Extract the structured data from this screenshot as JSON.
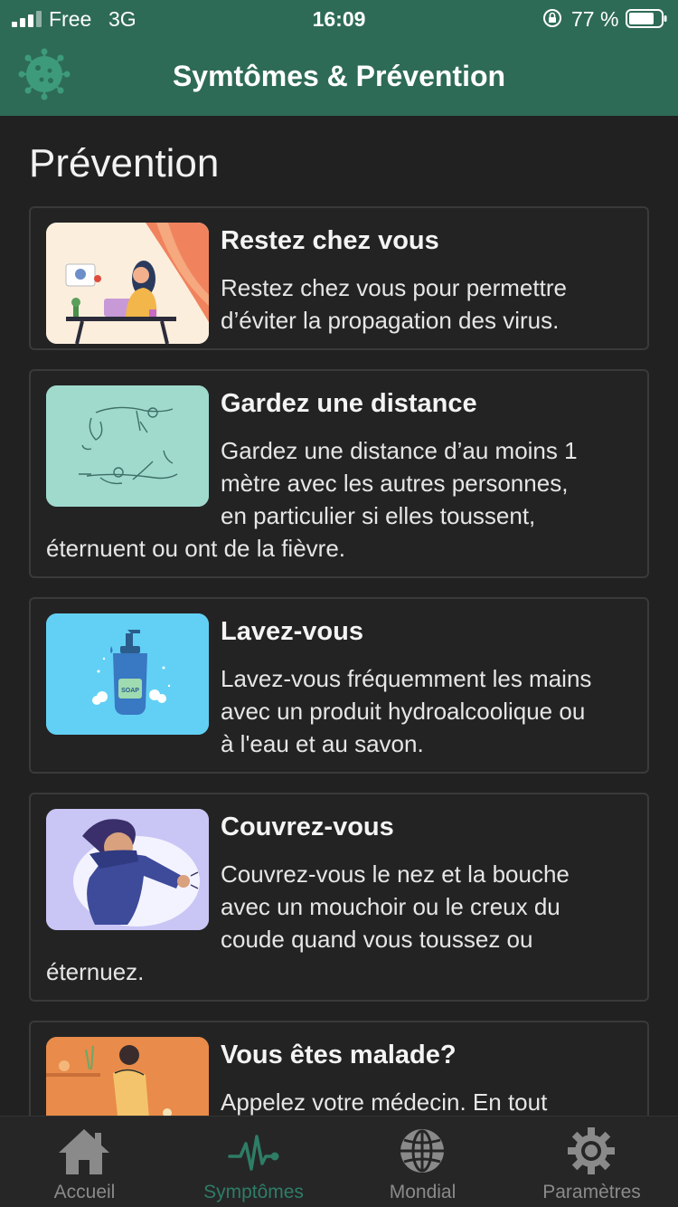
{
  "status_bar": {
    "carrier": "Free",
    "network": "3G",
    "time": "16:09",
    "battery": "77 %"
  },
  "header": {
    "title": "Symtômes & Prévention",
    "logo_icon": "virus-icon"
  },
  "page": {
    "title": "Prévention"
  },
  "cards": [
    {
      "title": "Restez chez vous",
      "lines": [
        "Restez chez vous pour permettre",
        "d’éviter la propagation des virus."
      ],
      "illustration": "woman-at-laptop-illustration"
    },
    {
      "title": "Gardez une distance",
      "lines": [
        "Gardez une distance d’au moins 1",
        "mètre avec les autres personnes,",
        "en particulier si elles toussent,",
        "éternuent ou ont de la fièvre."
      ],
      "illustration": "distance-illustration"
    },
    {
      "title": "Lavez-vous",
      "lines": [
        "Lavez-vous fréquemment les mains",
        "avec un produit hydroalcoolique ou",
        "à l'eau et au savon."
      ],
      "illustration": "soap-bottle-illustration",
      "soap_label": "SOAP"
    },
    {
      "title": "Couvrez-vous",
      "lines": [
        "Couvrez-vous le nez et la bouche",
        "avec un mouchoir ou le creux du",
        "coude quand vous toussez ou",
        "éternuez."
      ],
      "illustration": "sneeze-elbow-illustration"
    },
    {
      "title": "Vous êtes malade?",
      "lines": [
        "Appelez votre médecin. En tout"
      ],
      "illustration": "sick-person-illustration"
    }
  ],
  "tabs": [
    {
      "label": "Accueil",
      "icon": "home-icon",
      "active": false
    },
    {
      "label": "Symptômes",
      "icon": "heartbeat-icon",
      "active": true
    },
    {
      "label": "Mondial",
      "icon": "globe-icon",
      "active": false
    },
    {
      "label": "Paramètres",
      "icon": "gear-icon",
      "active": false
    }
  ],
  "colors": {
    "header_green": "#2e6b57",
    "background": "#212121",
    "active_tab": "#2e7d66",
    "inactive_tab": "#8a8a8a"
  }
}
